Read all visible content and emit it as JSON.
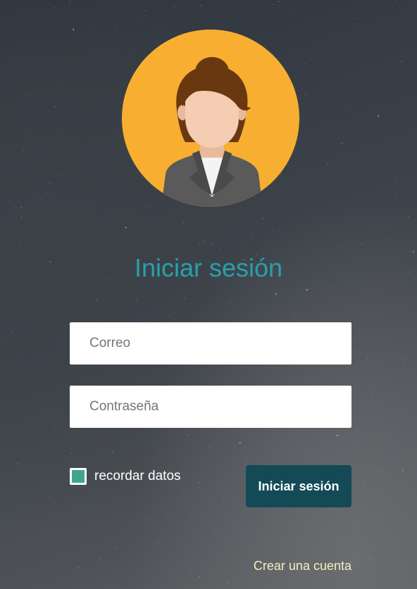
{
  "login": {
    "title": "Iniciar sesión",
    "email_placeholder": "Correo",
    "password_placeholder": "Contraseña",
    "remember_label": "recordar datos",
    "remember_checked": true,
    "submit_label": "Iniciar sesión",
    "create_account_label": "Crear una cuenta"
  },
  "avatar": {
    "icon": "woman-avatar-icon",
    "background_color": "#f8af31"
  },
  "colors": {
    "title": "#2aa0aa",
    "button": "#134a55",
    "checkbox": "#3fa58f",
    "link": "#f3efc0"
  }
}
